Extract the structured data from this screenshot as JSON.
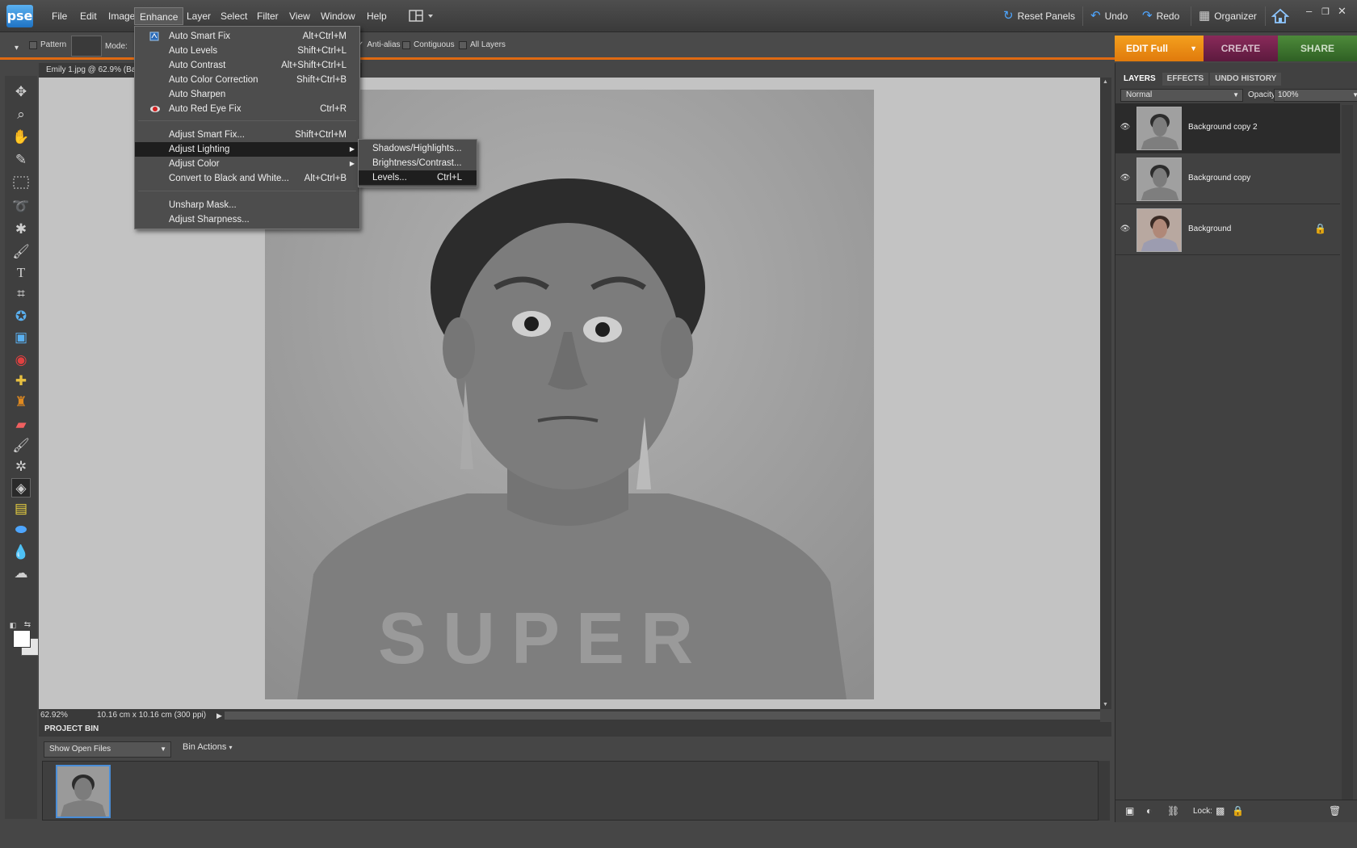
{
  "app": {
    "logo": "pse",
    "menus": [
      "File",
      "Edit",
      "Image",
      "Enhance",
      "Layer",
      "Select",
      "Filter",
      "View",
      "Window",
      "Help"
    ],
    "active_menu": "Enhance",
    "right_tools": {
      "reset_panels": "Reset Panels",
      "undo": "Undo",
      "redo": "Redo",
      "organizer": "Organizer"
    },
    "window_controls": {
      "minimize": "–",
      "restore": "❐",
      "close": "✕"
    }
  },
  "options_bar": {
    "pattern_label": "Pattern",
    "mode_label": "Mode:",
    "anti_alias": "Anti-alias",
    "contiguous": "Contiguous",
    "all_layers": "All Layers"
  },
  "mode_tabs": {
    "edit": "EDIT Full",
    "create": "CREATE",
    "share": "SHARE"
  },
  "document": {
    "tab_title": "Emily 1.jpg @ 62.9% (Bac",
    "zoom": "62.92%",
    "doc_size": "10.16 cm x 10.16 cm (300 ppi)"
  },
  "project_bin": {
    "header": "PROJECT BIN",
    "show_select": "Show Open Files",
    "bin_actions": "Bin Actions"
  },
  "layers_panel": {
    "tabs": [
      "LAYERS",
      "EFFECTS",
      "UNDO HISTORY"
    ],
    "blend_mode": "Normal",
    "opacity_label": "Opacity:",
    "opacity_value": "100%",
    "layers": [
      {
        "name": "Background copy 2"
      },
      {
        "name": "Background copy"
      },
      {
        "name": "Background"
      }
    ],
    "lock_label": "Lock:"
  },
  "enhance_menu": {
    "items": [
      {
        "label": "Auto Smart Fix",
        "shortcut": "Alt+Ctrl+M"
      },
      {
        "label": "Auto Levels",
        "shortcut": "Shift+Ctrl+L"
      },
      {
        "label": "Auto Contrast",
        "shortcut": "Alt+Shift+Ctrl+L"
      },
      {
        "label": "Auto Color Correction",
        "shortcut": "Shift+Ctrl+B"
      },
      {
        "label": "Auto Sharpen",
        "shortcut": ""
      },
      {
        "label": "Auto Red Eye Fix",
        "shortcut": "Ctrl+R"
      },
      {
        "label": "Adjust Smart Fix...",
        "shortcut": "Shift+Ctrl+M"
      },
      {
        "label": "Adjust Lighting",
        "shortcut": ""
      },
      {
        "label": "Adjust Color",
        "shortcut": ""
      },
      {
        "label": "Convert to Black and White...",
        "shortcut": "Alt+Ctrl+B"
      },
      {
        "label": "Unsharp Mask...",
        "shortcut": ""
      },
      {
        "label": "Adjust Sharpness...",
        "shortcut": ""
      }
    ]
  },
  "lighting_submenu": {
    "items": [
      {
        "label": "Shadows/Highlights...",
        "shortcut": ""
      },
      {
        "label": "Brightness/Contrast...",
        "shortcut": ""
      },
      {
        "label": "Levels...",
        "shortcut": "Ctrl+L"
      }
    ]
  },
  "tools": [
    "move-tool-icon",
    "zoom-tool-icon",
    "hand-tool-icon",
    "eyedropper-tool-icon",
    "marquee-tool-icon",
    "lasso-tool-icon",
    "magic-wand-tool-icon",
    "quick-selection-tool-icon",
    "type-tool-icon",
    "crop-tool-icon",
    "cookie-cutter-tool-icon",
    "straighten-tool-icon",
    "red-eye-tool-icon",
    "healing-brush-tool-icon",
    "clone-stamp-tool-icon",
    "eraser-tool-icon",
    "brush-tool-icon",
    "smart-brush-tool-icon",
    "paint-bucket-tool-icon",
    "gradient-tool-icon",
    "shape-tool-icon",
    "blur-tool-icon",
    "sponge-tool-icon"
  ],
  "colors": {
    "accent": "#e06a12",
    "edit_tab": "#f09419",
    "create_tab": "#7a2450",
    "share_tab": "#3f7a2e",
    "selection_blue": "#4a8ed8"
  }
}
